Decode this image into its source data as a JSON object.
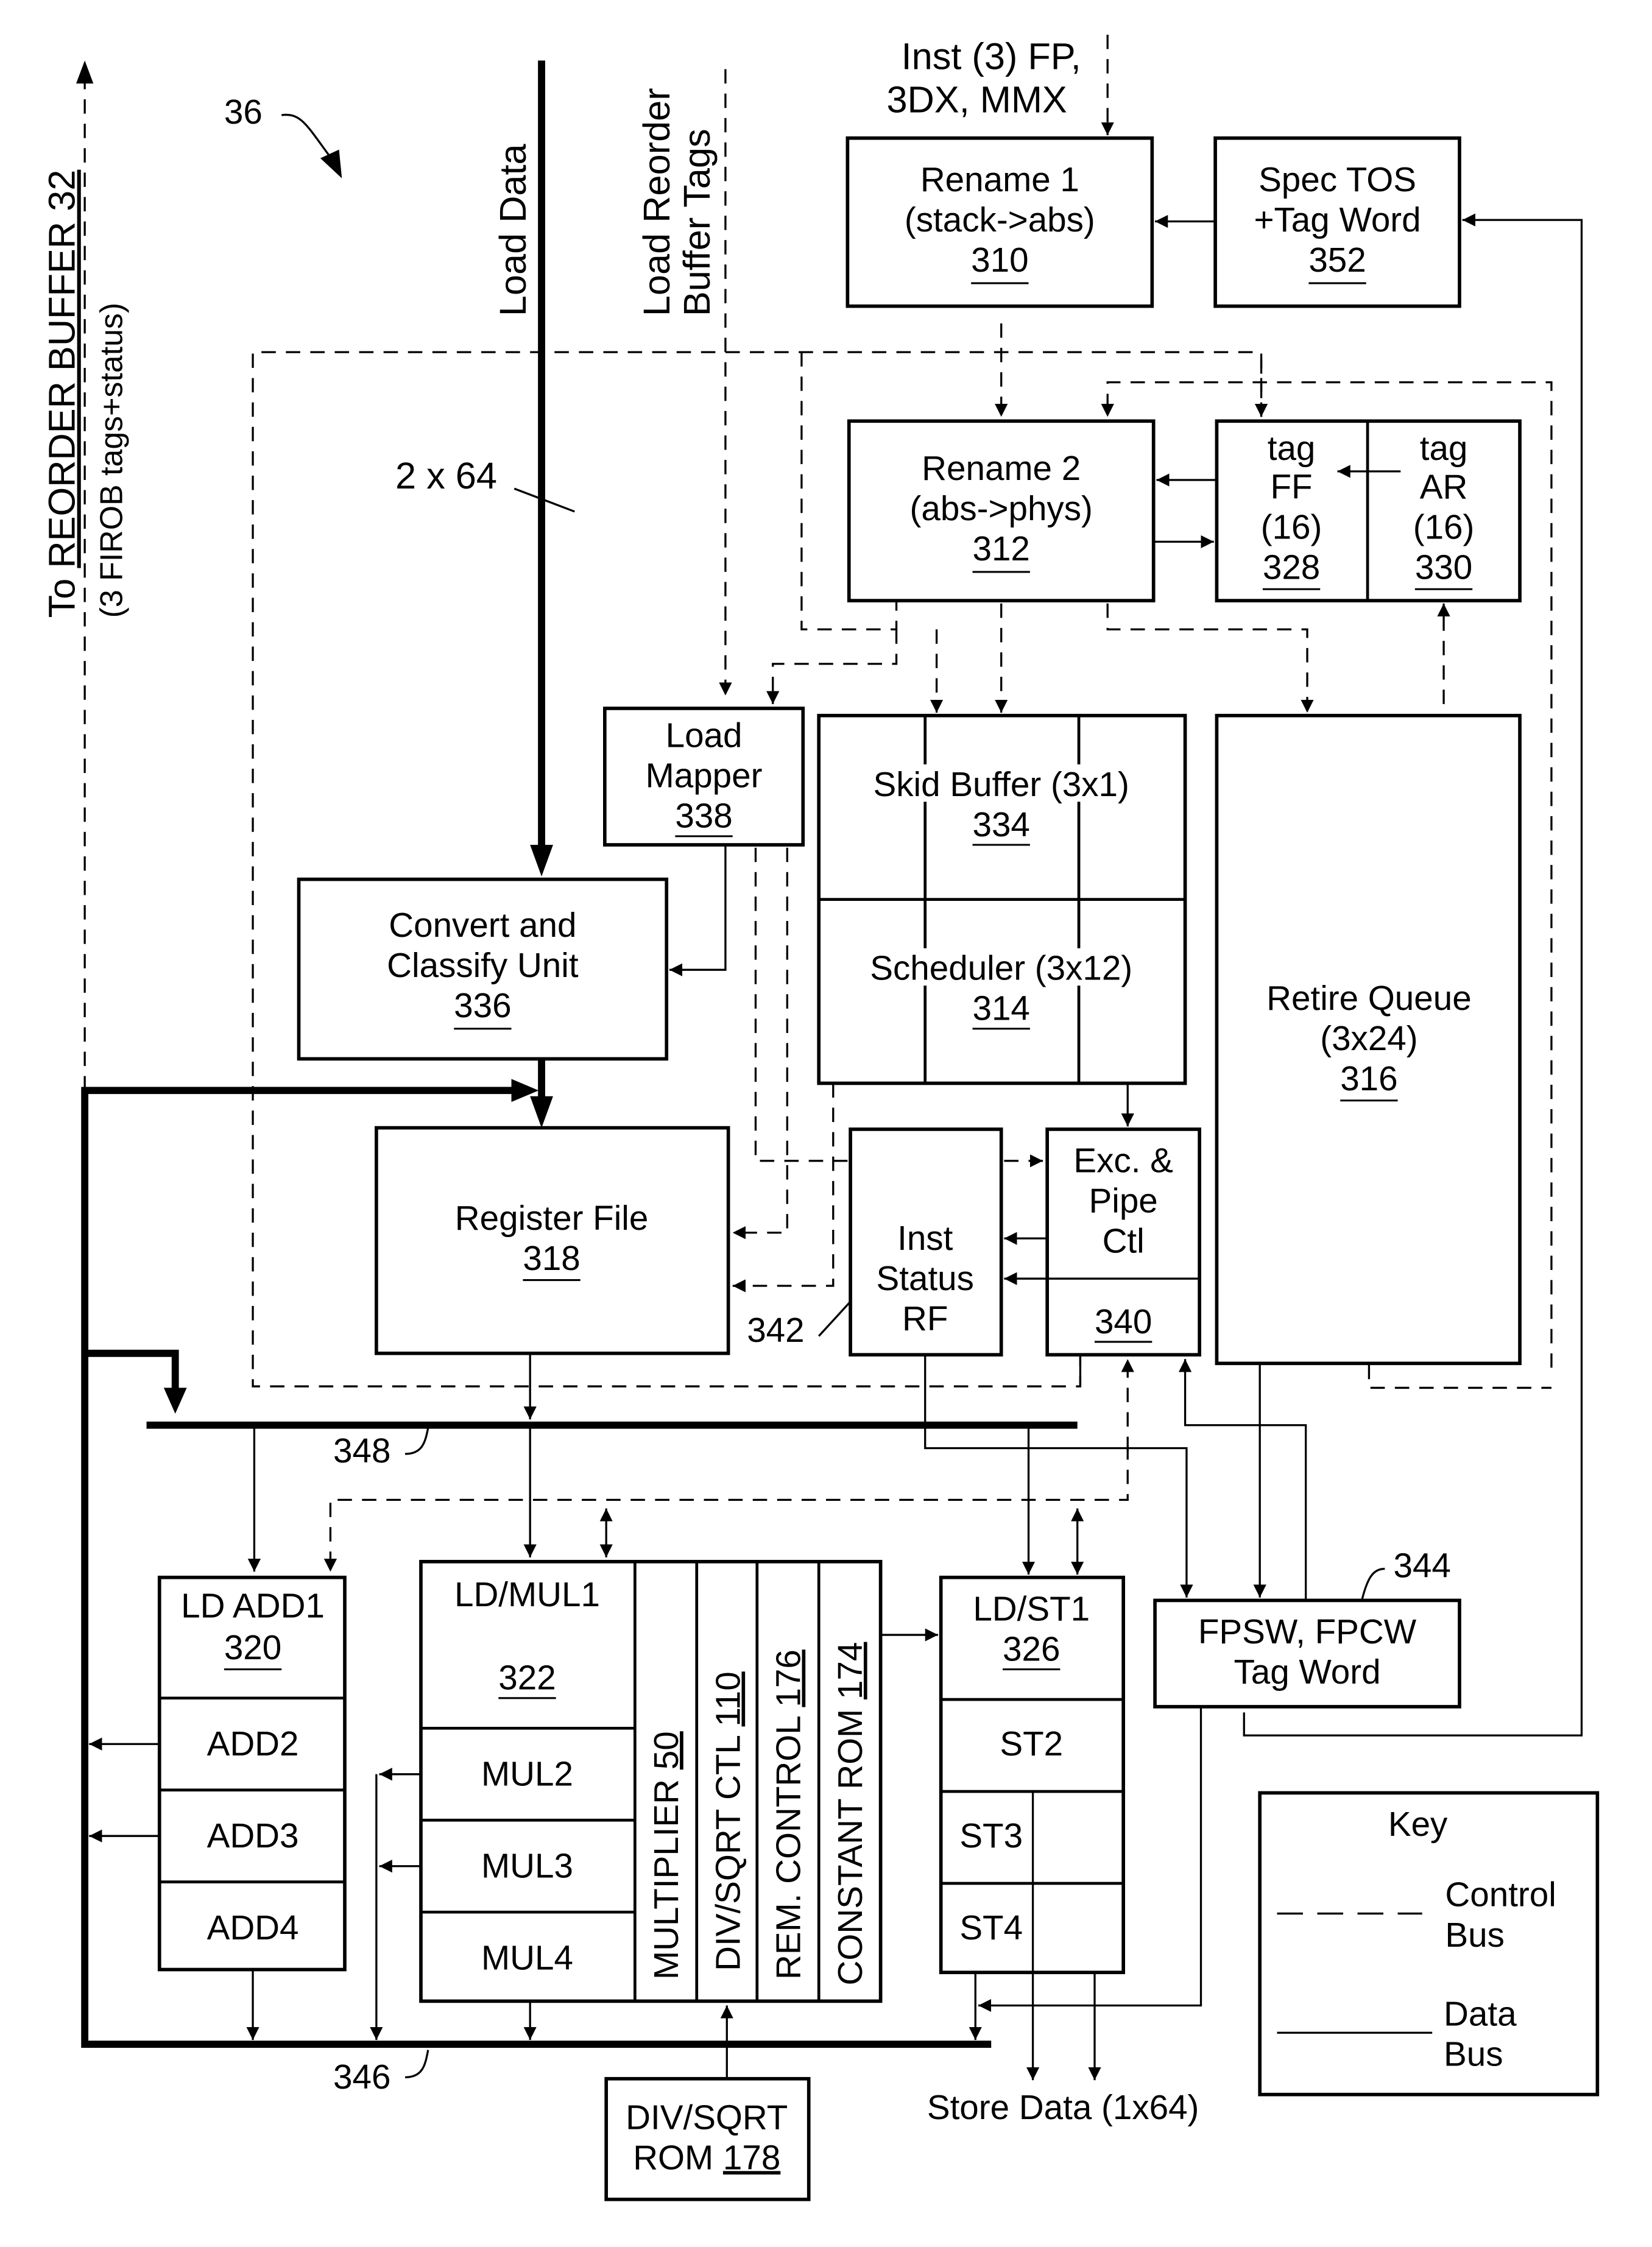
{
  "figure": {
    "ref": "36",
    "colors": {
      "ink": "#000000",
      "paper": "#ffffff"
    }
  },
  "labels": {
    "reorder_buffer_line1_prefix": "To ",
    "reorder_buffer_line1": "REORDER BUFFER 32",
    "reorder_buffer_line2": "(3 FIROB tags+status)",
    "load_data": "Load Data",
    "load_rob_tags_1": "Load Reorder",
    "load_rob_tags_2": "Buffer Tags",
    "inst_in_1": "Inst (3) FP,",
    "inst_in_2": "3DX, MMX",
    "width_2x64": "2 x 64",
    "ref_342": "342",
    "ref_348": "348",
    "ref_346": "346",
    "ref_344": "344",
    "store_data": "Store Data (1x64)"
  },
  "blocks": {
    "rename1": {
      "line1": "Rename 1",
      "line2": "(stack->abs)",
      "ref": "310"
    },
    "spec_tos": {
      "line1": "Spec TOS",
      "line2": "+Tag Word",
      "ref": "352"
    },
    "rename2": {
      "line1": "Rename 2",
      "line2": "(abs->phys)",
      "ref": "312"
    },
    "tag_ff": {
      "line1": "tag",
      "line2": "FF",
      "line3": "(16)",
      "ref": "328"
    },
    "tag_ar": {
      "line1": "tag",
      "line2": "AR",
      "line3": "(16)",
      "ref": "330"
    },
    "load_mapper": {
      "line1": "Load",
      "line2": "Mapper",
      "ref": "338"
    },
    "skid_buffer": {
      "line1": "Skid Buffer (3x1)",
      "ref": "334"
    },
    "scheduler": {
      "line1": "Scheduler (3x12)",
      "ref": "314"
    },
    "retire_queue": {
      "line1": "Retire Queue",
      "line2": "(3x24)",
      "ref": "316"
    },
    "convert_classify": {
      "line1": "Convert and",
      "line2": "Classify Unit",
      "ref": "336"
    },
    "register_file": {
      "line1": "Register File",
      "ref": "318"
    },
    "inst_status_rf": {
      "line1": "Inst",
      "line2": "Status",
      "line3": "RF"
    },
    "exc_pipe": {
      "line1": "Exc. &",
      "line2": "Pipe",
      "line3": "Ctl",
      "ref": "340"
    },
    "ld_add": {
      "line1": "LD ADD1",
      "ref": "320",
      "stages": [
        "ADD2",
        "ADD3",
        "ADD4"
      ]
    },
    "ld_mul": {
      "line1": "LD/MUL1",
      "ref": "322",
      "stages": [
        "MUL2",
        "MUL3",
        "MUL4"
      ]
    },
    "multiplier": {
      "label": "MULTIPLIER ",
      "ref": "50"
    },
    "div_sqrt_ctl": {
      "label": "DIV/SQRT CTL ",
      "ref": "110"
    },
    "rem_control": {
      "label": "REM. CONTROL ",
      "ref": "176"
    },
    "constant_rom": {
      "label": "CONSTANT ROM ",
      "ref": "174"
    },
    "ld_st": {
      "line1": "LD/ST1",
      "ref": "326",
      "stages": [
        "ST2",
        "ST3",
        "ST4"
      ]
    },
    "fpsw": {
      "line1": "FPSW, FPCW",
      "line2": "Tag Word"
    },
    "div_sqrt_rom": {
      "line1": "DIV/SQRT",
      "line2_prefix": "ROM ",
      "ref": "178"
    }
  },
  "key": {
    "title": "Key",
    "items": [
      {
        "style": "dashed",
        "line1": "Control",
        "line2": "Bus"
      },
      {
        "style": "solid",
        "line1": "Data",
        "line2": "Bus"
      }
    ]
  }
}
